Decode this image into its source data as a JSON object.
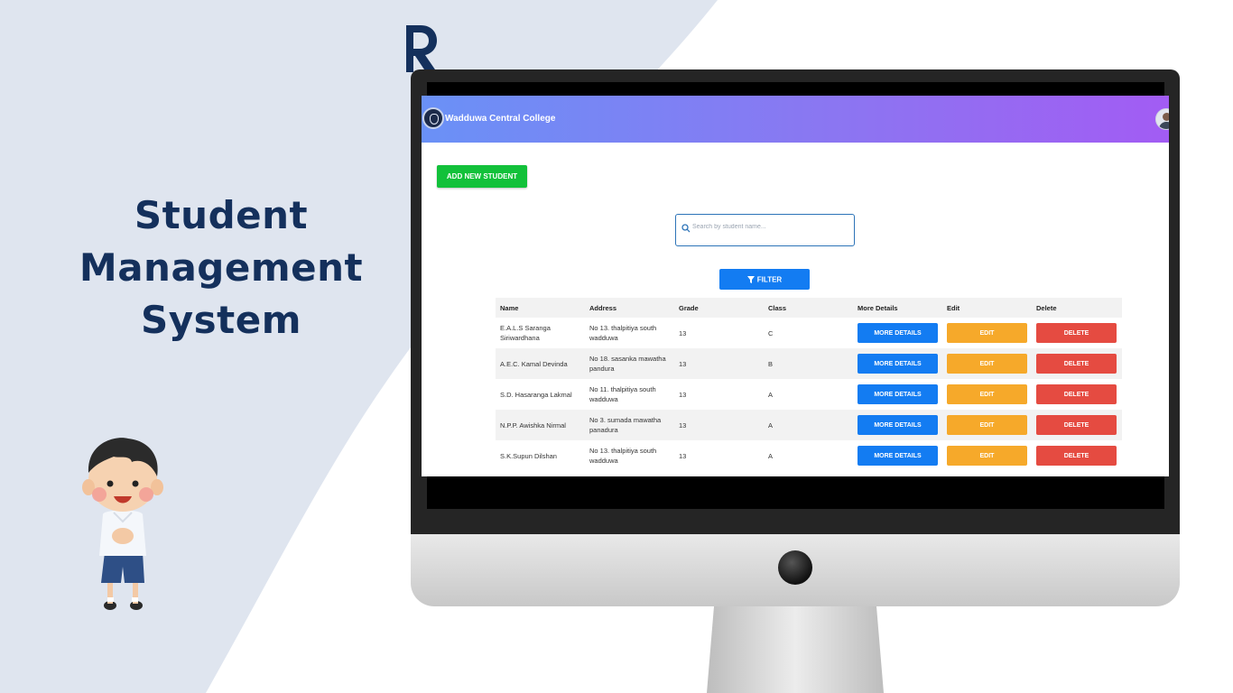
{
  "headline": {
    "line1": "Student",
    "line2": "Management",
    "line3": "System"
  },
  "colors": {
    "accent": "#14305c",
    "background_shape": "#dfe5ef",
    "navbar_start": "#6a91f6",
    "navbar_end": "#a25cf3",
    "add_button": "#12c13a",
    "primary_button": "#137cf2",
    "edit_button": "#f6a92a",
    "delete_button": "#e54b41"
  },
  "app": {
    "navbar": {
      "brand": "Wadduwa Central College",
      "logo_icon": "college-crest-icon",
      "avatar_icon": "user-avatar-icon"
    },
    "add_button_label": "ADD NEW STUDENT",
    "search": {
      "placeholder": "Search by student name...",
      "value": ""
    },
    "filter_button_label": "FILTER",
    "table": {
      "headers": {
        "name": "Name",
        "address": "Address",
        "grade": "Grade",
        "class": "Class",
        "more": "More Details",
        "edit": "Edit",
        "delete": "Delete"
      },
      "rows": [
        {
          "name_1": "E.A.L.S Saranga",
          "name_2": "Siriwardhana",
          "addr_1": "No 13. thalpitiya south",
          "addr_2": "wadduwa",
          "grade": "13",
          "class": "C",
          "more": "MORE DETAILS",
          "edit": "EDIT",
          "delete": "DELETE"
        },
        {
          "name_1": "A.E.C. Kamal Devinda",
          "name_2": "",
          "addr_1": "No 18. sasanka mawatha",
          "addr_2": "pandura",
          "grade": "13",
          "class": "B",
          "more": "MORE DETAILS",
          "edit": "EDIT",
          "delete": "DELETE"
        },
        {
          "name_1": "S.D. Hasaranga Lakmal",
          "name_2": "",
          "addr_1": "No 11. thalpitiya south",
          "addr_2": "wadduwa",
          "grade": "13",
          "class": "A",
          "more": "MORE DETAILS",
          "edit": "EDIT",
          "delete": "DELETE"
        },
        {
          "name_1": "N.P.P. Awishka Nirmal",
          "name_2": "",
          "addr_1": "No 3. sumada mawatha",
          "addr_2": "panadura",
          "grade": "13",
          "class": "A",
          "more": "MORE DETAILS",
          "edit": "EDIT",
          "delete": "DELETE"
        },
        {
          "name_1": "S.K.Supun Dilshan",
          "name_2": "",
          "addr_1": "No 13. thalpitiya south",
          "addr_2": "wadduwa",
          "grade": "13",
          "class": "A",
          "more": "MORE DETAILS",
          "edit": "EDIT",
          "delete": "DELETE"
        }
      ]
    }
  }
}
